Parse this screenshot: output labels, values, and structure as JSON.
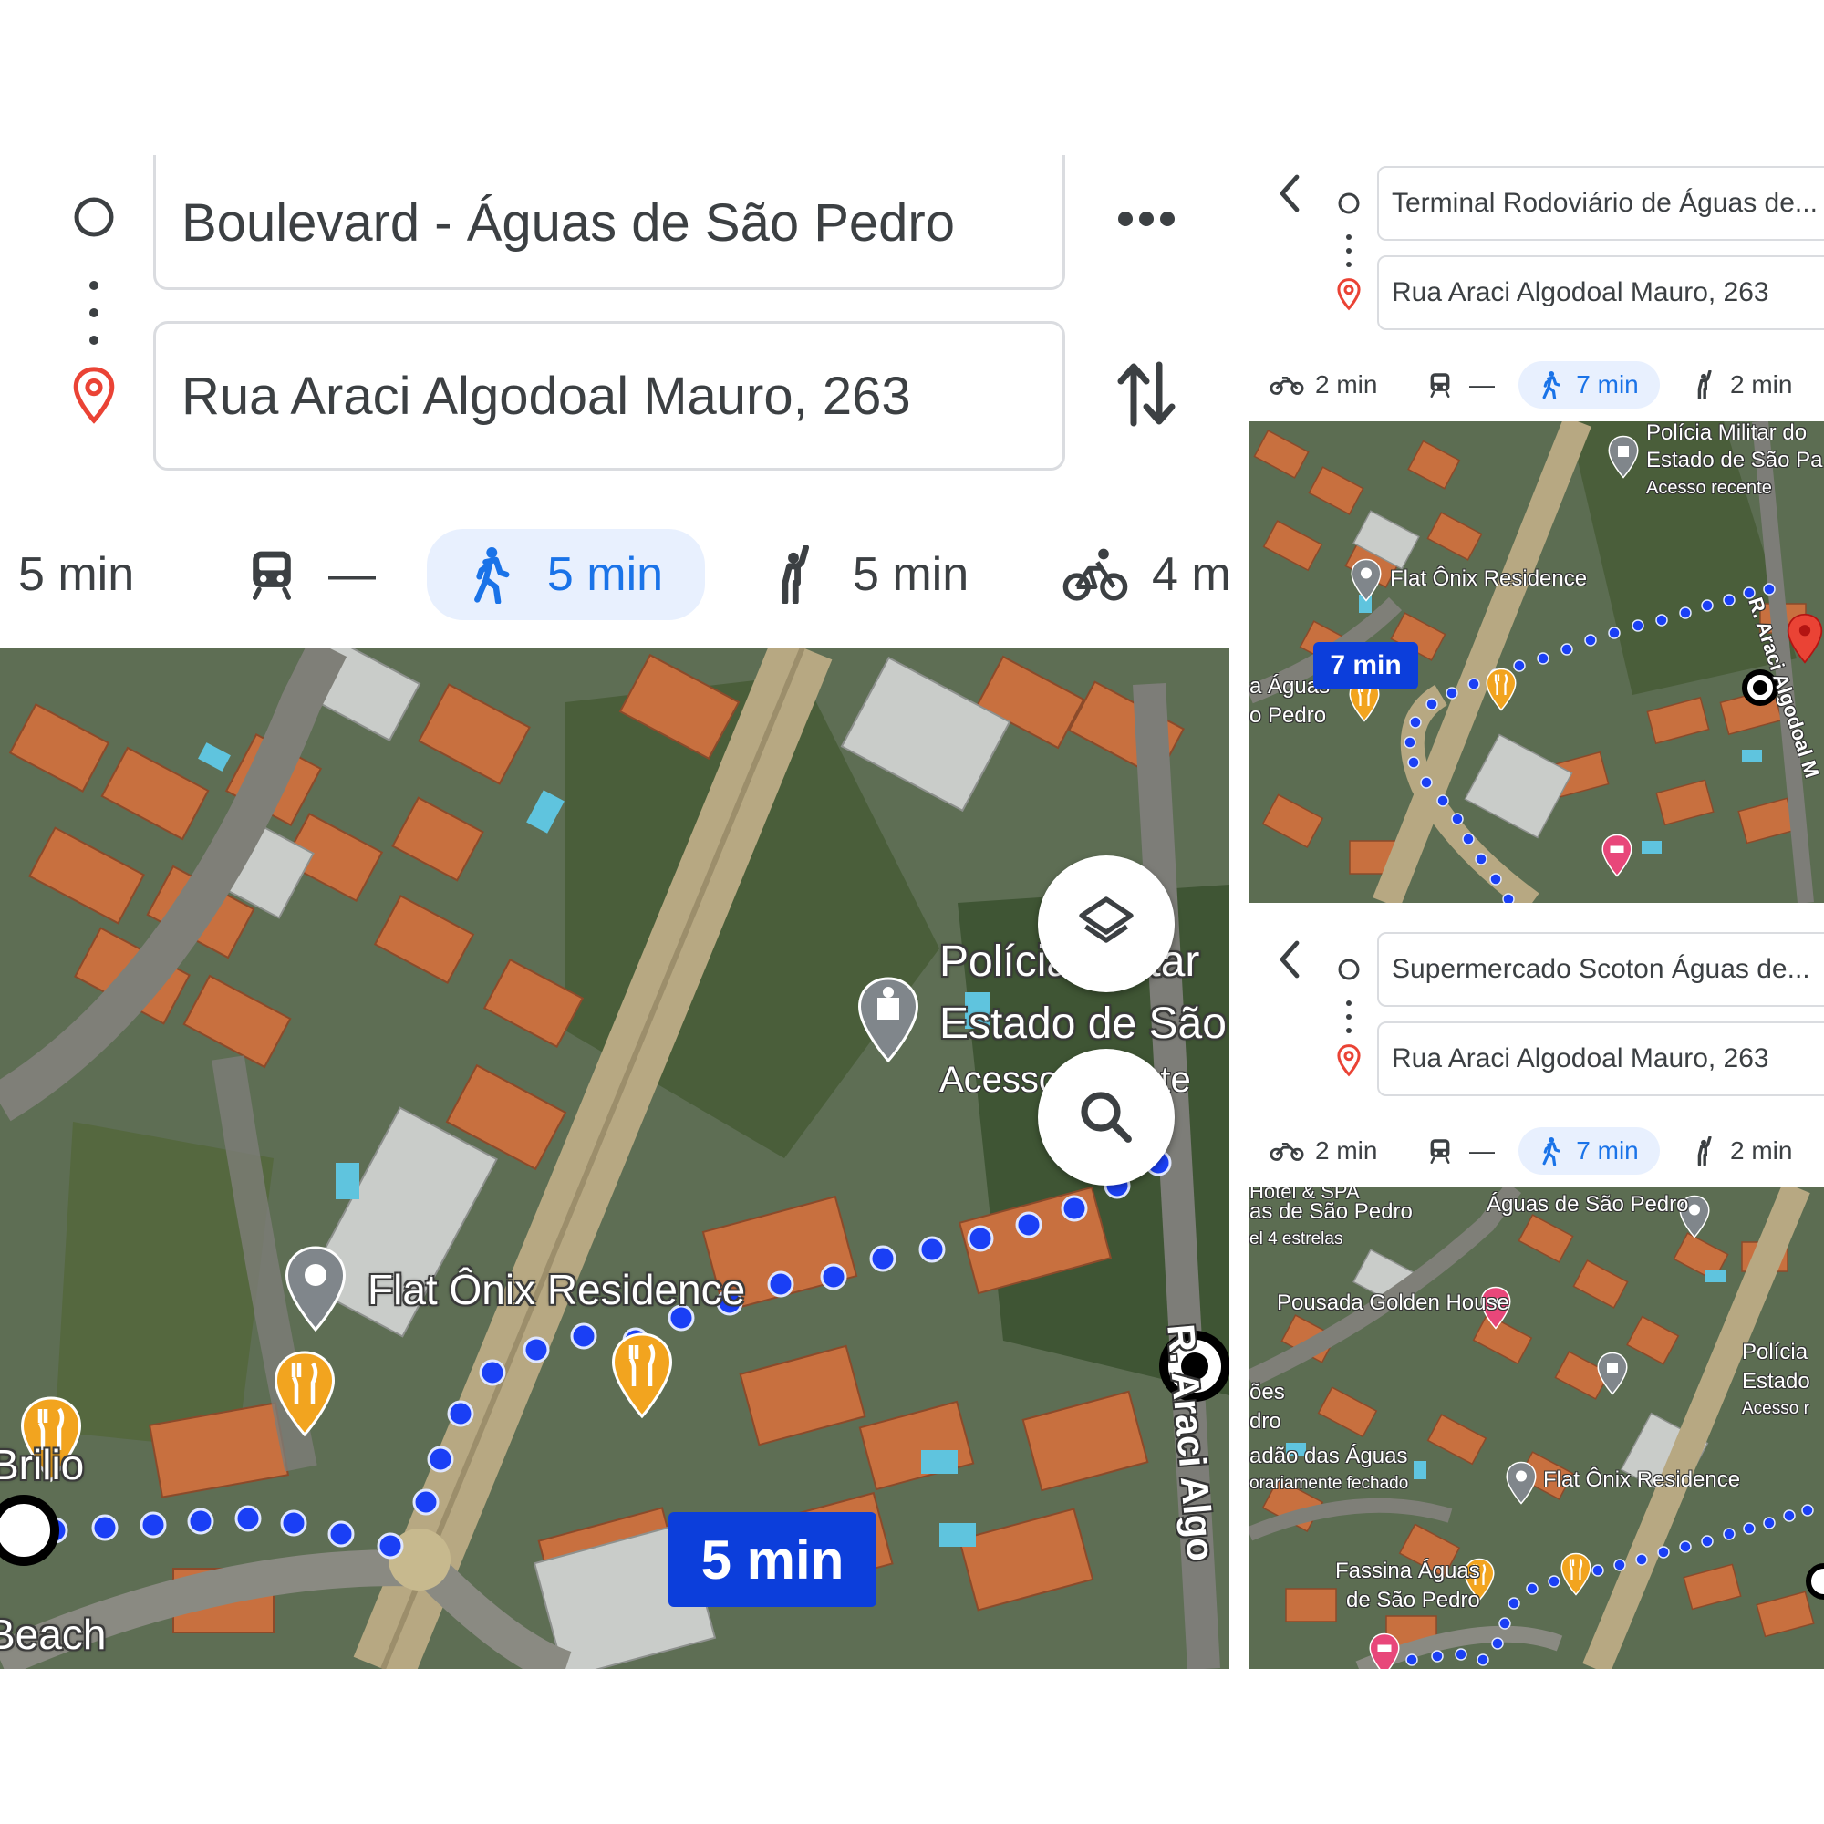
{
  "main": {
    "origin": {
      "value": "Boulevard - Águas de São Pedro"
    },
    "destination": {
      "value": "Rua Araci Algodoal Mauro, 263"
    },
    "modes": [
      {
        "icon": "car-icon",
        "label": "5 min"
      },
      {
        "icon": "transit-icon",
        "label": "—"
      },
      {
        "icon": "walk-icon",
        "label": "5 min",
        "active": true
      },
      {
        "icon": "ride-hail-icon",
        "label": "5 min"
      },
      {
        "icon": "bike-icon",
        "label": "4 m"
      }
    ],
    "map": {
      "eta": "5 min",
      "pois": {
        "flat": "Flat Ônix Residence",
        "policia1": "Polícia Militar",
        "policia2": "Estado de São",
        "policia3": "Acesso recente",
        "brilio": "Brilio",
        "beach": "Beach"
      },
      "street": "R. Araci Algo"
    }
  },
  "panel_a": {
    "origin": {
      "value": "Terminal Rodoviário de Águas de..."
    },
    "destination": {
      "value": "Rua Araci Algodoal Mauro, 263"
    },
    "modes": [
      {
        "icon": "motorcycle-icon",
        "label": "2 min"
      },
      {
        "icon": "transit-icon",
        "label": "—"
      },
      {
        "icon": "walk-icon",
        "label": "7 min",
        "active": true
      },
      {
        "icon": "ride-hail-icon",
        "label": "2 min"
      }
    ],
    "map": {
      "eta": "7 min",
      "pois": {
        "policia1": "Polícia Militar do",
        "policia2": "Estado de São Pa",
        "policia3": "Acesso recente",
        "flat": "Flat Ônix Residence",
        "aguas1": "a Águas",
        "aguas2": "o Pedro"
      },
      "street": "R. Araci Algodoal M"
    }
  },
  "panel_b": {
    "origin": {
      "value": "Supermercado Scoton Águas de..."
    },
    "destination": {
      "value": "Rua Araci Algodoal Mauro, 263"
    },
    "modes": [
      {
        "icon": "motorcycle-icon",
        "label": "2 min"
      },
      {
        "icon": "transit-icon",
        "label": "—"
      },
      {
        "icon": "walk-icon",
        "label": "7 min",
        "active": true
      },
      {
        "icon": "ride-hail-icon",
        "label": "2 min"
      }
    ],
    "map": {
      "pois": {
        "hotel1": "Hotel & SPA",
        "hotel2": "as de São Pedro",
        "hotel3": "el 4 estrelas",
        "aguas": "Águas de São Pedro",
        "pousada": "Pousada Golden House",
        "policia1": "Polícia",
        "policia2": "Estado",
        "policia3": "Acesso r",
        "soes": "ões",
        "dro": "dro",
        "cidadao": "adão das Águas",
        "fechado": "orariamente fechado",
        "flat": "Flat Ônix Residence",
        "fassina1": "Fassina Águas",
        "fassina2": "de São Pedro"
      }
    }
  },
  "colors": {
    "route": "#1a3ff5",
    "eta_bg": "#0c3edb",
    "active_mode_bg": "#e8f0fe",
    "active_mode_fg": "#1a73e8",
    "restaurant_pin": "#f2a41f",
    "destination_pin": "#ea4335"
  }
}
